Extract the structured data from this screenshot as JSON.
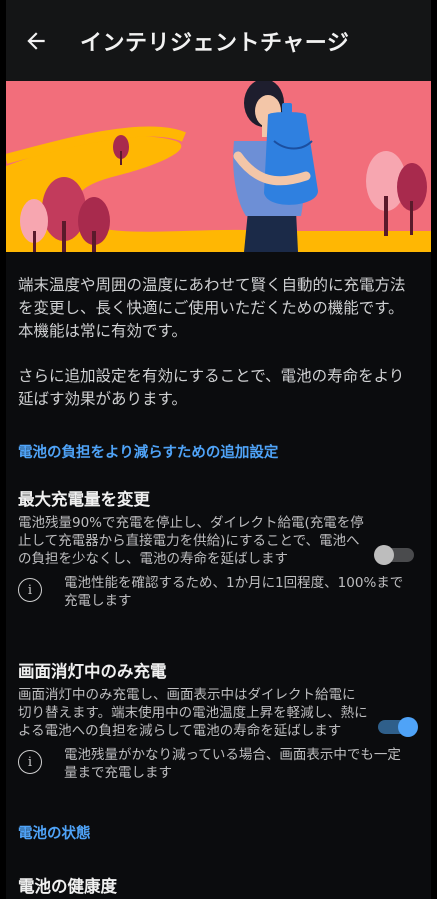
{
  "appbar": {
    "title": "インテリジェントチャージ"
  },
  "intro": {
    "paragraph1": "端末温度や周囲の温度にあわせて賢く自動的に充電方法を変更し、長く快適にご使用いただくための機能です。本機能は常に有効です。",
    "paragraph2": "さらに追加設定を有効にすることで、電池の寿命をより延ばす効果があります。"
  },
  "section_extra": {
    "header": "電池の負担をより減らすための追加設定"
  },
  "max_charge": {
    "title": "最大充電量を変更",
    "description": "電池残量90%で充電を停止し、ダイレクト給電(充電を停止して充電器から直接電力を供給)にすることで、電池への負担を少なくし、電池の寿命を延ばします",
    "note": "電池性能を確認するため、1か月に1回程度、100%まで充電します",
    "enabled": false
  },
  "screen_off_charge": {
    "title": "画面消灯中のみ充電",
    "description": "画面消灯中のみ充電し、画面表示中はダイレクト給電に切り替えます。端末使用中の電池温度上昇を軽減し、熱による電池への負担を減らして電池の寿命を延ばします",
    "note": "電池残量がかなり減っている場合、画面表示中でも一定量まで充電します",
    "enabled": true
  },
  "section_status": {
    "header": "電池の状態"
  },
  "battery_health": {
    "title": "電池の健康度"
  },
  "colors": {
    "accent": "#4fa3f7",
    "hero_bg": "#f26e7b",
    "path": "#ffb703"
  }
}
